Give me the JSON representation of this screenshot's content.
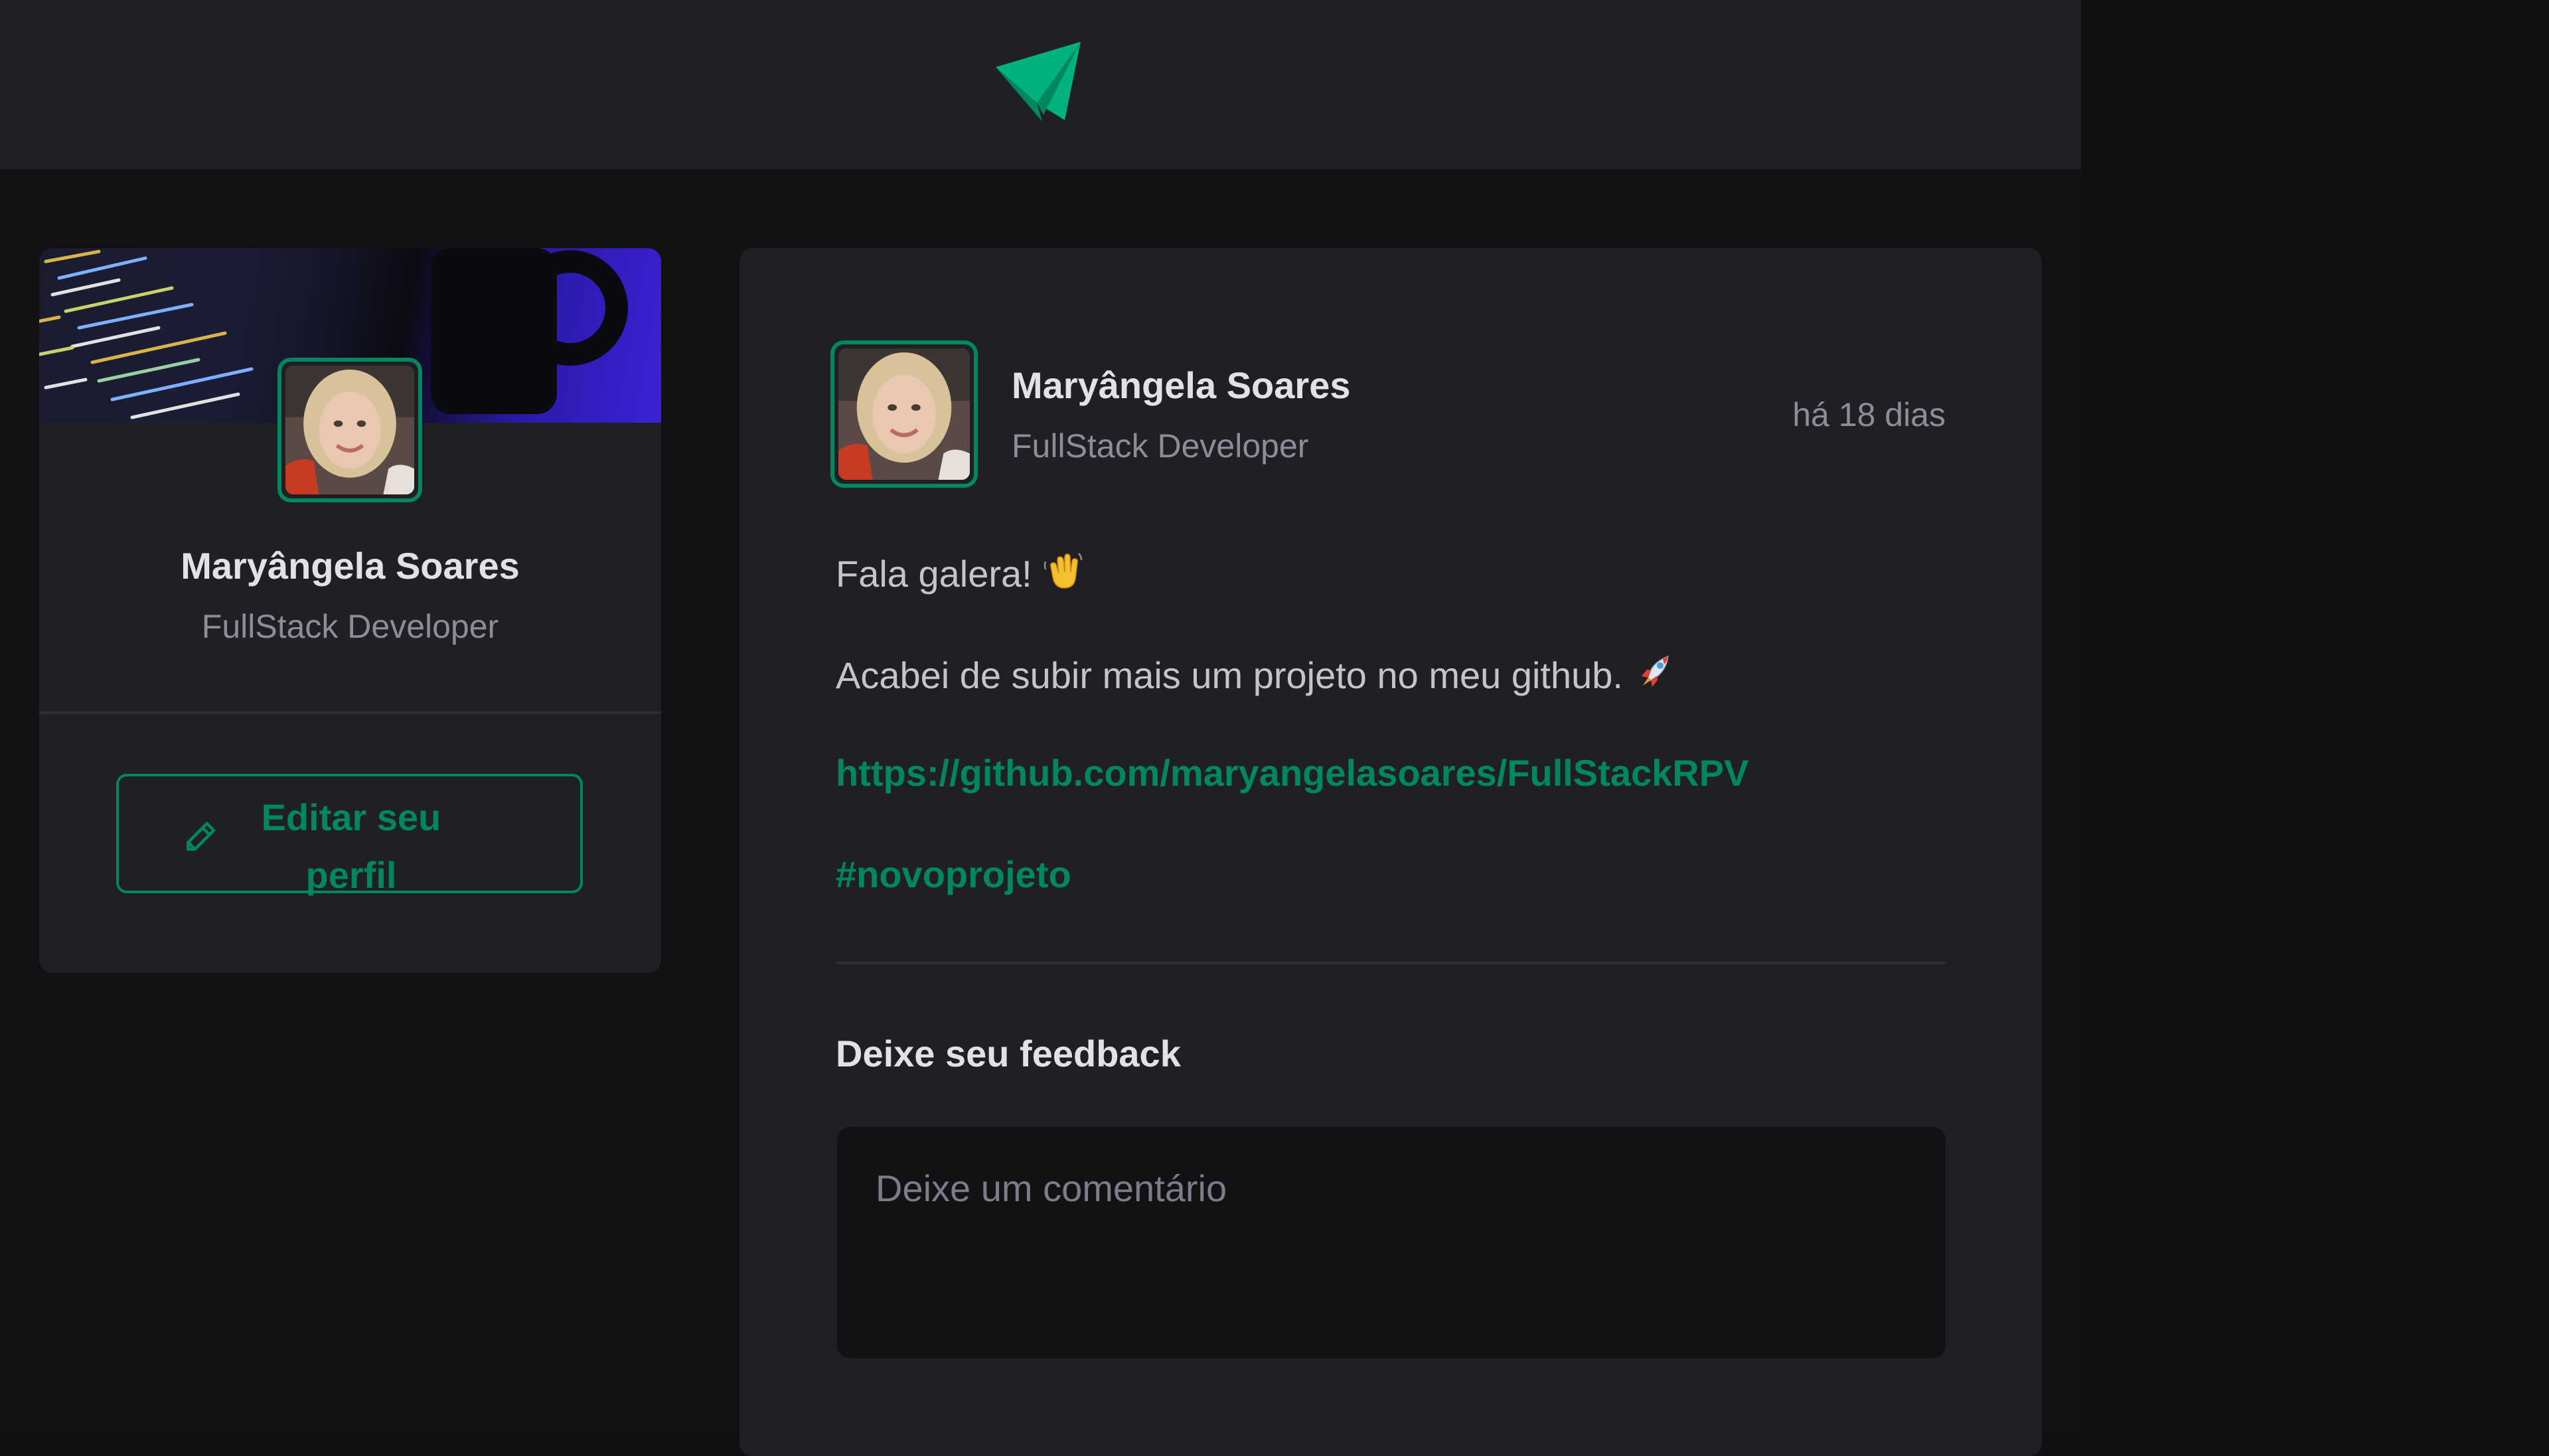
{
  "colors": {
    "background": "#121214",
    "surface": "#202024",
    "brand_green": "#00875f",
    "title_text": "#e1e1e6",
    "body_text": "#c4c4cc",
    "muted_text": "#8d8d99",
    "divider": "#2f2f36"
  },
  "header": {
    "logo_icon": "paper-plane-icon"
  },
  "sidebar": {
    "cover_image": "code-and-mug-cover-image",
    "avatar": "profile-photo",
    "name": "Maryângela Soares",
    "role": "FullStack Developer",
    "edit_button": {
      "icon": "pencil-icon",
      "label": "Editar seu perfil"
    }
  },
  "post": {
    "author": {
      "avatar": "profile-photo",
      "name": "Maryângela Soares",
      "role": "FullStack Developer"
    },
    "published": "há 18 dias",
    "content": {
      "greeting": "Fala galera!",
      "greeting_emoji": "waving-hand-icon",
      "message": "Acabei de subir mais um projeto no meu github.",
      "message_emoji": "rocket-icon",
      "link": "https://github.com/maryangelasoares/FullStackRPV",
      "hashtag": "#novoprojeto"
    },
    "feedback": {
      "title": "Deixe seu feedback",
      "placeholder": "Deixe um comentário",
      "value": ""
    }
  }
}
